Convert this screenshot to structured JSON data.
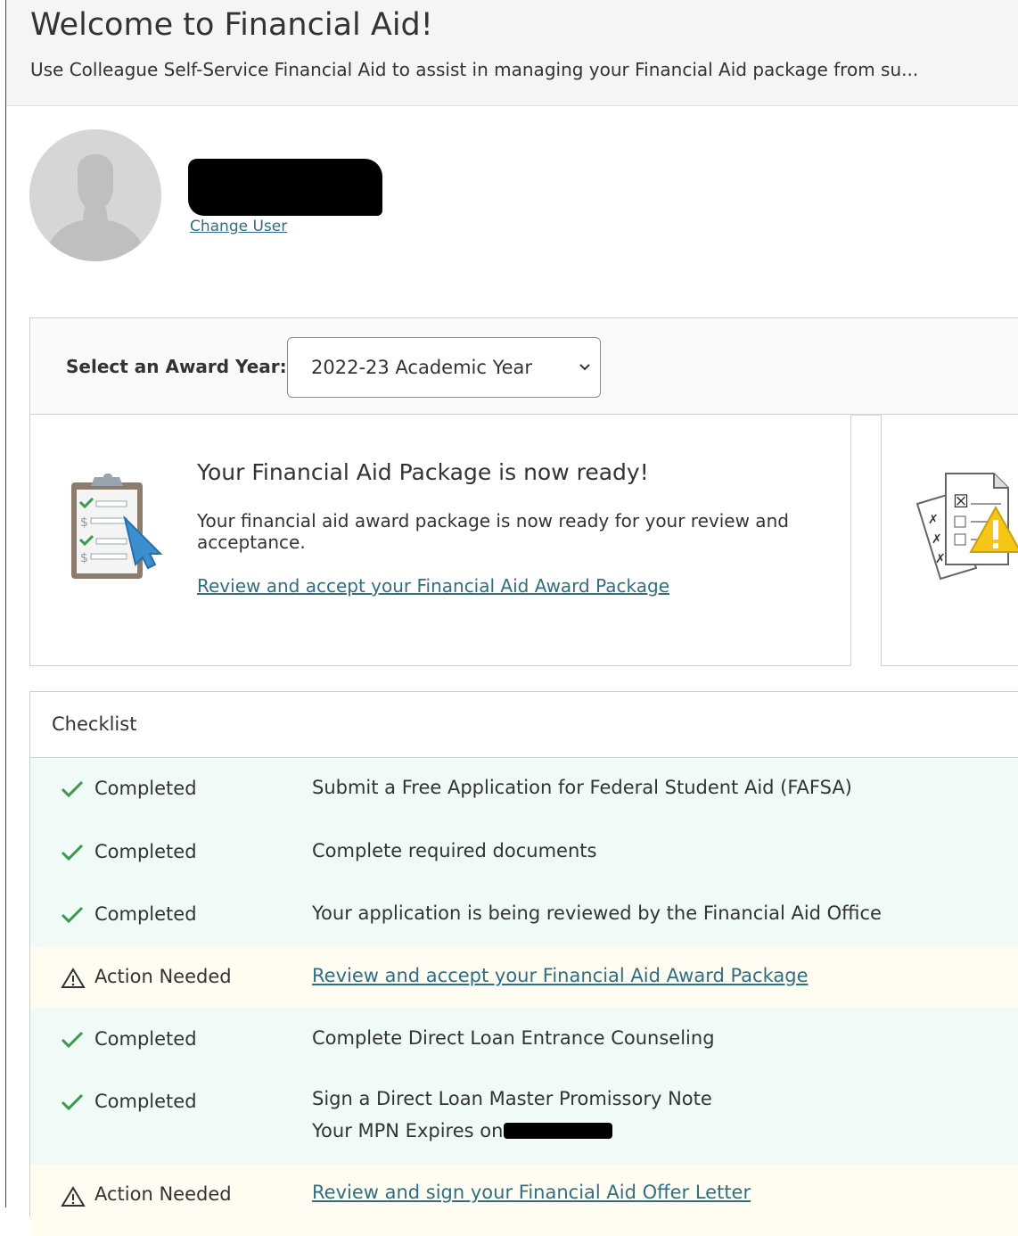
{
  "header": {
    "title": "Welcome to Financial Aid!",
    "subtitle": "Use Colleague Self-Service Financial Aid to assist in managing your Financial Aid package from su..."
  },
  "user": {
    "change_user_label": "Change User"
  },
  "award_year": {
    "label": "Select an Award Year:",
    "selected": "2022-23 Academic Year"
  },
  "package_card": {
    "title": "Your Financial Aid Package is now ready!",
    "description": "Your financial aid award package is now ready for your review and acceptance.",
    "link": "Review and accept your Financial Aid Award Package"
  },
  "checklist": {
    "heading": "Checklist",
    "items": [
      {
        "status": "Completed",
        "text": "Submit a Free Application for Federal Student Aid (FAFSA)"
      },
      {
        "status": "Completed",
        "text": "Complete required documents"
      },
      {
        "status": "Completed",
        "text": "Your application is being reviewed by the Financial Aid Office"
      },
      {
        "status": "Action Needed",
        "text": "Review and accept your Financial Aid Award Package"
      },
      {
        "status": "Completed",
        "text": "Complete Direct Loan Entrance Counseling"
      },
      {
        "status": "Completed",
        "text": "Sign a Direct Loan Master Promissory Note",
        "sub": "Your MPN Expires on"
      },
      {
        "status": "Action Needed",
        "text": "Review and sign your Financial Aid Offer Letter"
      }
    ]
  },
  "colors": {
    "link": "#2f6f84",
    "completed_bg": "#f0fbf8",
    "action_bg": "#fffdf1",
    "check_green": "#3a9a4a"
  },
  "icons": {
    "user": "user-avatar-silhouette",
    "package": "clipboard-checklist-icon",
    "offer": "documents-warning-icon",
    "completed": "check-icon",
    "action": "warning-triangle-icon"
  }
}
